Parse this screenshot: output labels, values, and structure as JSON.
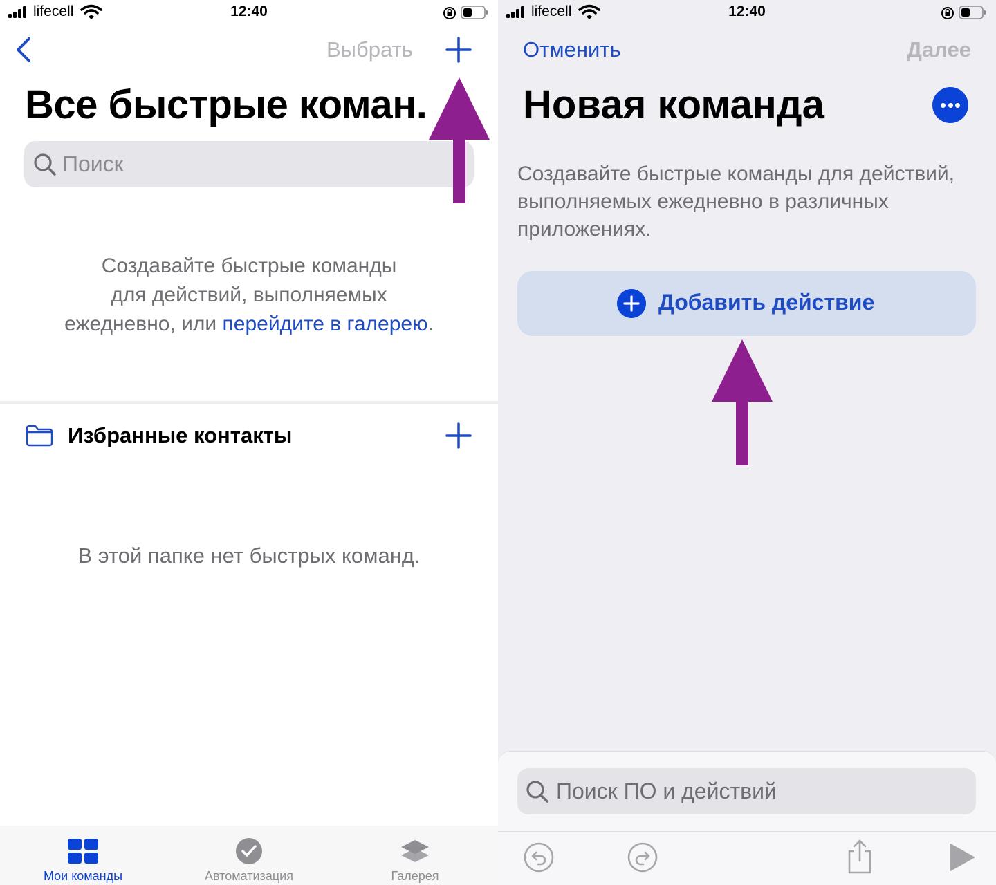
{
  "status_bar": {
    "carrier": "lifecell",
    "time": "12:40"
  },
  "left": {
    "nav": {
      "select_label": "Выбрать"
    },
    "title": "Все быстрые коман.",
    "search": {
      "placeholder": "Поиск"
    },
    "empty": {
      "line1": "Создавайте быстрые команды",
      "line2": "для действий, выполняемых",
      "line3_prefix": "ежедневно, или ",
      "link": "перейдите в галерею",
      "suffix": "."
    },
    "folder": {
      "title": "Избранные контакты",
      "empty_text": "В этой папке нет быстрых команд."
    },
    "tabs": [
      {
        "label": "Мои команды",
        "icon": "grid-icon"
      },
      {
        "label": "Автоматизация",
        "icon": "clock-check-icon"
      },
      {
        "label": "Галерея",
        "icon": "layers-icon"
      }
    ]
  },
  "right": {
    "nav": {
      "cancel_label": "Отменить",
      "next_label": "Далее"
    },
    "title": "Новая команда",
    "description": "Создавайте быстрые команды для действий, выполняемых ежедневно в различных приложениях.",
    "add_action_label": "Добавить действие",
    "sheet": {
      "search_placeholder": "Поиск ПО и действий"
    }
  },
  "colors": {
    "accent": "#1f4cc2",
    "accent_fill": "#0b43d6",
    "annotation_arrow": "#8e1f8e",
    "disabled_text": "#b6b6bb",
    "secondary_text": "#6d6d72"
  }
}
